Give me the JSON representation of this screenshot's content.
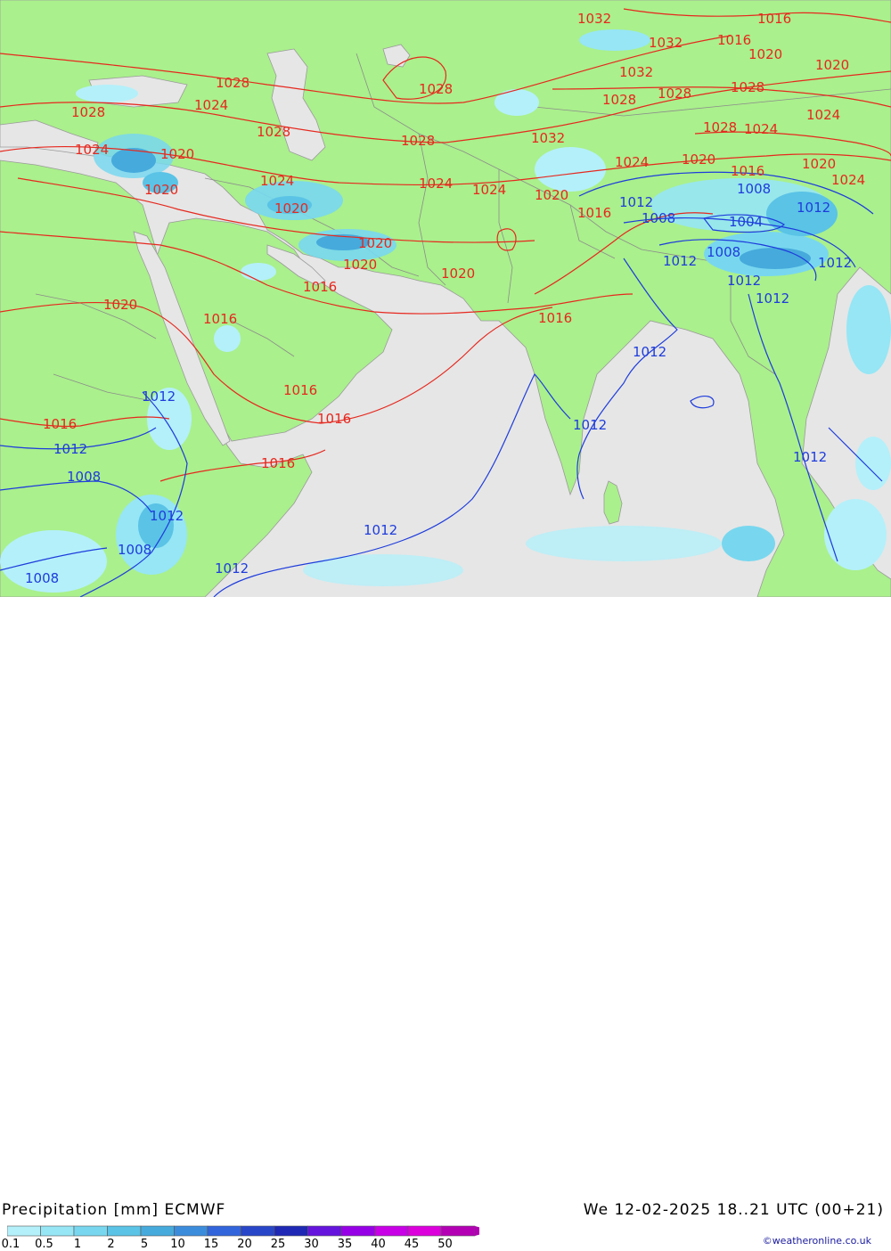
{
  "header": {
    "title": "Precipitation [mm] ECMWF",
    "valid_time": "We 12-02-2025 18..21 UTC (00+21)",
    "credit": "©weatheronline.co.uk"
  },
  "legend": {
    "labels": [
      "0.1",
      "0.5",
      "1",
      "2",
      "5",
      "10",
      "15",
      "20",
      "25",
      "30",
      "35",
      "40",
      "45",
      "50"
    ],
    "colors": [
      "#b4f0fa",
      "#96e6f5",
      "#78d7ef",
      "#5ac3e6",
      "#46aadc",
      "#3c8cdc",
      "#3264dc",
      "#2846c8",
      "#1e28b4",
      "#6414dc",
      "#9600e6",
      "#c800e6",
      "#dc00dc",
      "#b400b4"
    ]
  },
  "map": {
    "land_color": "#aaf08c",
    "sea_color": "#e6e6e6",
    "high_isobar_color": "#e6281e",
    "low_isobar_color": "#1e3cdc",
    "isobar_labels_red": [
      "1032",
      "1016",
      "1032",
      "1016",
      "1020",
      "1020",
      "1028",
      "1032",
      "1028",
      "1028",
      "1028",
      "1028",
      "1024",
      "1028",
      "1024",
      "1028",
      "1024",
      "1020",
      "1028",
      "1032",
      "1028",
      "1024",
      "1024",
      "1024",
      "1020",
      "1020",
      "1020",
      "1016",
      "1024",
      "1020",
      "1024",
      "1024",
      "1020",
      "1016",
      "1020",
      "1020",
      "1020",
      "1016",
      "1020",
      "1016",
      "1016",
      "1016",
      "1016",
      "1016",
      "1016"
    ],
    "isobar_labels_blue": [
      "1012",
      "1008",
      "1008",
      "1004",
      "1012",
      "1008",
      "1012",
      "1012",
      "1012",
      "1012",
      "1012",
      "1012",
      "1012",
      "1008",
      "1012",
      "1008",
      "1012",
      "1008",
      "1012",
      "1012",
      "1012"
    ]
  }
}
